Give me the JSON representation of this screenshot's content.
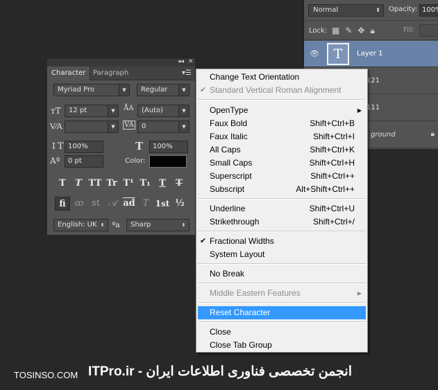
{
  "layers_panel": {
    "blend_mode": "Normal",
    "opacity_label": "Opacity:",
    "opacity_value": "100%",
    "lock_label": "Lock:",
    "fill_label": "Fill:",
    "layers": [
      {
        "name": "Layer 1",
        "thumb": "T",
        "selected": true,
        "visible": true
      },
      {
        "name": "121"
      },
      {
        "name": "111"
      },
      {
        "name": "ground",
        "locked": true
      }
    ]
  },
  "character_panel": {
    "tabs": [
      "Character",
      "Paragraph"
    ],
    "font_family": "Myriad Pro",
    "font_style": "Regular",
    "font_size": "12 pt",
    "leading": "(Auto)",
    "kerning": "",
    "tracking": "0",
    "vertical_scale": "100%",
    "horizontal_scale": "100%",
    "baseline_shift": "0 pt",
    "color_label": "Color:",
    "color_value": "#050505",
    "style_buttons": [
      "T",
      "T",
      "TT",
      "Tr",
      "T¹",
      "T₁",
      "T",
      "T"
    ],
    "opentype_buttons": [
      "fi",
      "st",
      "ad",
      "1st",
      "½"
    ],
    "language": "English: UK",
    "antialias_icon_text": "ªa",
    "antialias": "Sharp"
  },
  "context_menu": {
    "items": [
      {
        "label": "Change Text Orientation"
      },
      {
        "label": "Standard Vertical Roman Alignment",
        "checked": true,
        "disabled": true
      },
      {
        "label": "OpenType",
        "submenu": true
      },
      {
        "label": "Faux Bold",
        "shortcut": "Shift+Ctrl+B"
      },
      {
        "label": "Faux Italic",
        "shortcut": "Shift+Ctrl+I"
      },
      {
        "label": "All Caps",
        "shortcut": "Shift+Ctrl+K"
      },
      {
        "label": "Small Caps",
        "shortcut": "Shift+Ctrl+H"
      },
      {
        "label": "Superscript",
        "shortcut": "Shift+Ctrl++"
      },
      {
        "label": "Subscript",
        "shortcut": "Alt+Shift+Ctrl++"
      },
      {
        "label": "Underline",
        "shortcut": "Shift+Ctrl+U"
      },
      {
        "label": "Strikethrough",
        "shortcut": "Shift+Ctrl+/"
      },
      {
        "label": "Fractional Widths",
        "checked": true
      },
      {
        "label": "System Layout"
      },
      {
        "label": "No Break"
      },
      {
        "label": "Middle Eastern Features",
        "submenu": true,
        "disabled": true
      },
      {
        "label": "Reset Character",
        "highlighted": true
      },
      {
        "label": "Close"
      },
      {
        "label": "Close Tab Group"
      }
    ]
  },
  "watermark": {
    "left": "TOSINSO.COM",
    "right": "ITPro.ir - انجمن تخصصی فناوری اطلاعات ایران"
  }
}
